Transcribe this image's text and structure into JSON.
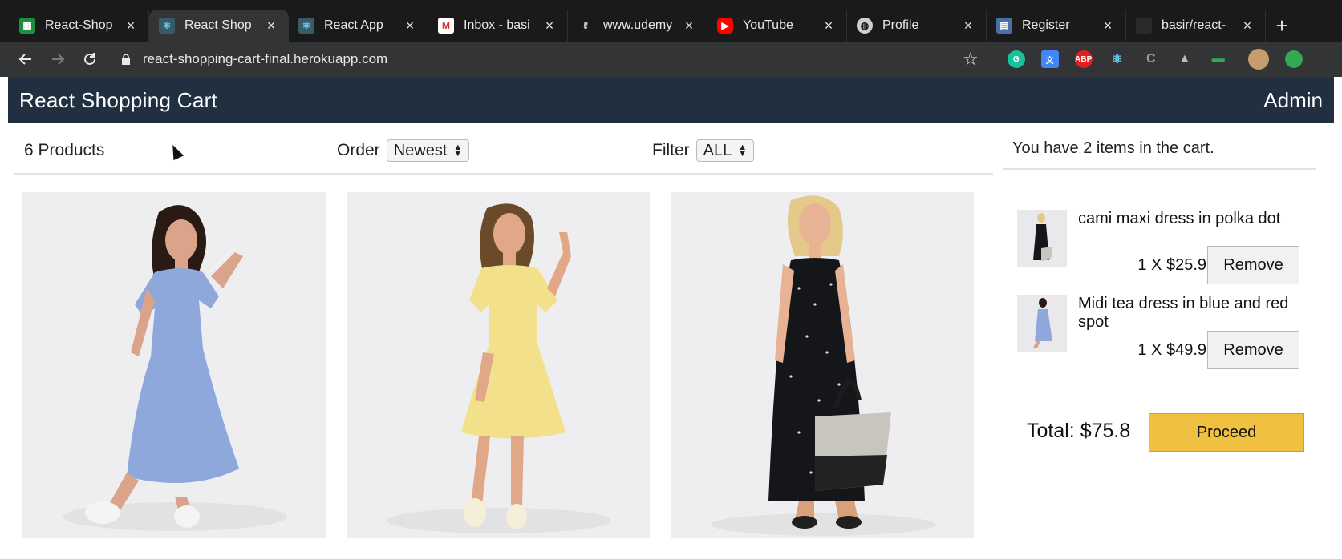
{
  "browser": {
    "tabs": [
      {
        "label": "React-Shop",
        "icon": "sheets-icon",
        "color": "#1e8e3e"
      },
      {
        "label": "React Shop",
        "icon": "react-icon",
        "color": "#61dafb"
      },
      {
        "label": "React App",
        "icon": "react-icon",
        "color": "#61dafb"
      },
      {
        "label": "Inbox - basi",
        "icon": "gmail-icon",
        "color": "#d93025"
      },
      {
        "label": "www.udemy",
        "icon": "udemy-icon",
        "color": "#a0a0a0"
      },
      {
        "label": "YouTube",
        "icon": "youtube-icon",
        "color": "#ff0000"
      },
      {
        "label": "Profile",
        "icon": "globe-icon",
        "color": "#cfcfcf"
      },
      {
        "label": "Register",
        "icon": "site-icon",
        "color": "#4a6fa5"
      },
      {
        "label": "basir/react-",
        "icon": "github-icon",
        "color": "#444444"
      }
    ],
    "url": "react-shopping-cart-final.herokuapp.com"
  },
  "app": {
    "title": "React Shopping Cart",
    "admin_label": "Admin"
  },
  "filter": {
    "count": "6 Products",
    "order_label": "Order",
    "order_value": "Newest",
    "filter_label": "Filter",
    "filter_value": "ALL"
  },
  "products": [
    {
      "name": "blue-polka-dress",
      "dress_color": "#8fa8dc",
      "hair_color": "#2a1a14"
    },
    {
      "name": "yellow-dress",
      "dress_color": "#f2e08a",
      "hair_color": "#6b4a2a"
    },
    {
      "name": "black-dot-dress",
      "dress_color": "#15161a",
      "hair_color": "#e5c98a"
    }
  ],
  "cart": {
    "summary": "You have 2 items in the cart.",
    "items": [
      {
        "title": "cami maxi dress in polka dot",
        "price": "1 X $25.9",
        "remove_label": "Remove",
        "dress_color": "#15161a"
      },
      {
        "title": "Midi tea dress in blue and red spot",
        "price": "1 X $49.9",
        "remove_label": "Remove",
        "dress_color": "#8fa8dc"
      }
    ],
    "total": "Total: $75.8",
    "proceed_label": "Proceed"
  },
  "colors": {
    "header_bg": "#203040",
    "proceed_bg": "#f0c040"
  }
}
